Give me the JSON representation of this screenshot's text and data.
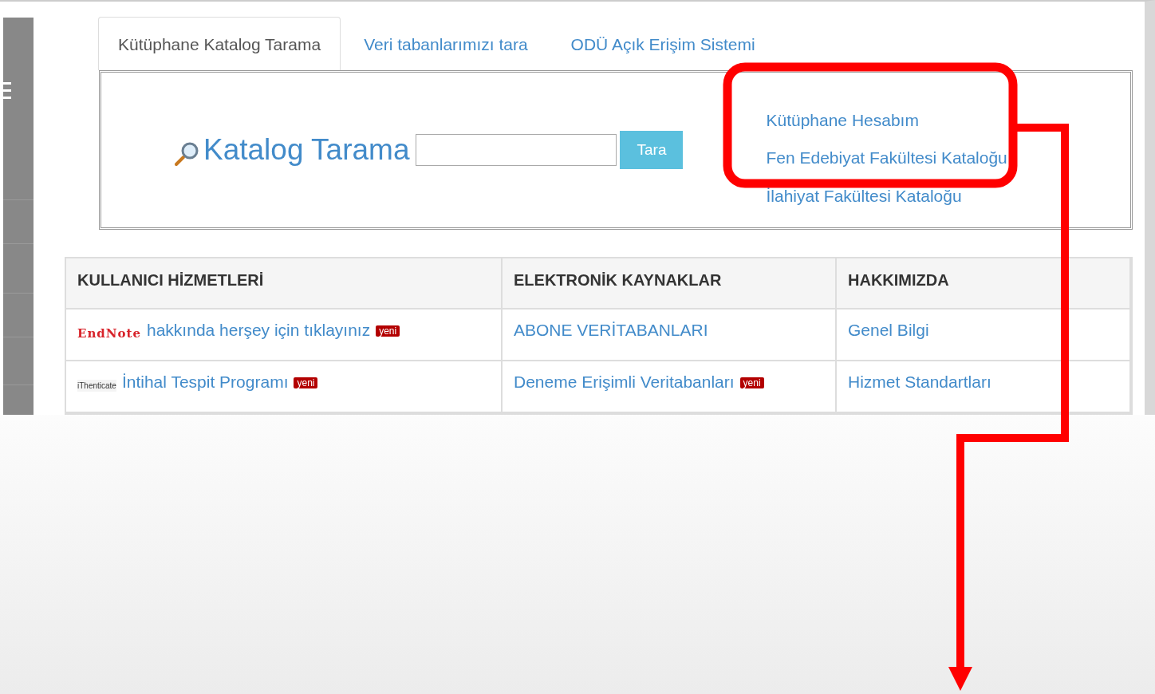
{
  "tabs": [
    {
      "label": "Kütüphane Katalog Tarama",
      "selected": true
    },
    {
      "label": "Veri tabanlarımızı tara",
      "selected": false
    },
    {
      "label": "ODÜ Açık Erişim Sistemi",
      "selected": false
    }
  ],
  "search": {
    "title": "Katalog Tarama",
    "button": "Tara"
  },
  "links": [
    "Kütüphane Hesabım",
    "Fen Edebiyat Fakültesi Kataloğu",
    "İlahiyat Fakültesi Kataloğu"
  ],
  "table": {
    "columns": [
      "KULLANICI HİZMETLERİ",
      "ELEKTRONİK KAYNAKLAR",
      "HAKKIMIZDA"
    ],
    "rows": [
      [
        {
          "kind": "endnote",
          "logo": "EndNote",
          "text": "hakkında herşey için tıklayınız",
          "badge": "yeni"
        },
        {
          "text": "ABONE VERİTABANLARI"
        },
        {
          "text": "Genel Bilgi"
        }
      ],
      [
        {
          "kind": "ithenticate",
          "logo": "iThenticate",
          "text": "İntihal Tespit Programı",
          "badge": "yeni"
        },
        {
          "text": "Deneme Erişimli Veritabanları",
          "badge": "yeni"
        },
        {
          "text": "Hizmet Standartları"
        }
      ]
    ]
  }
}
